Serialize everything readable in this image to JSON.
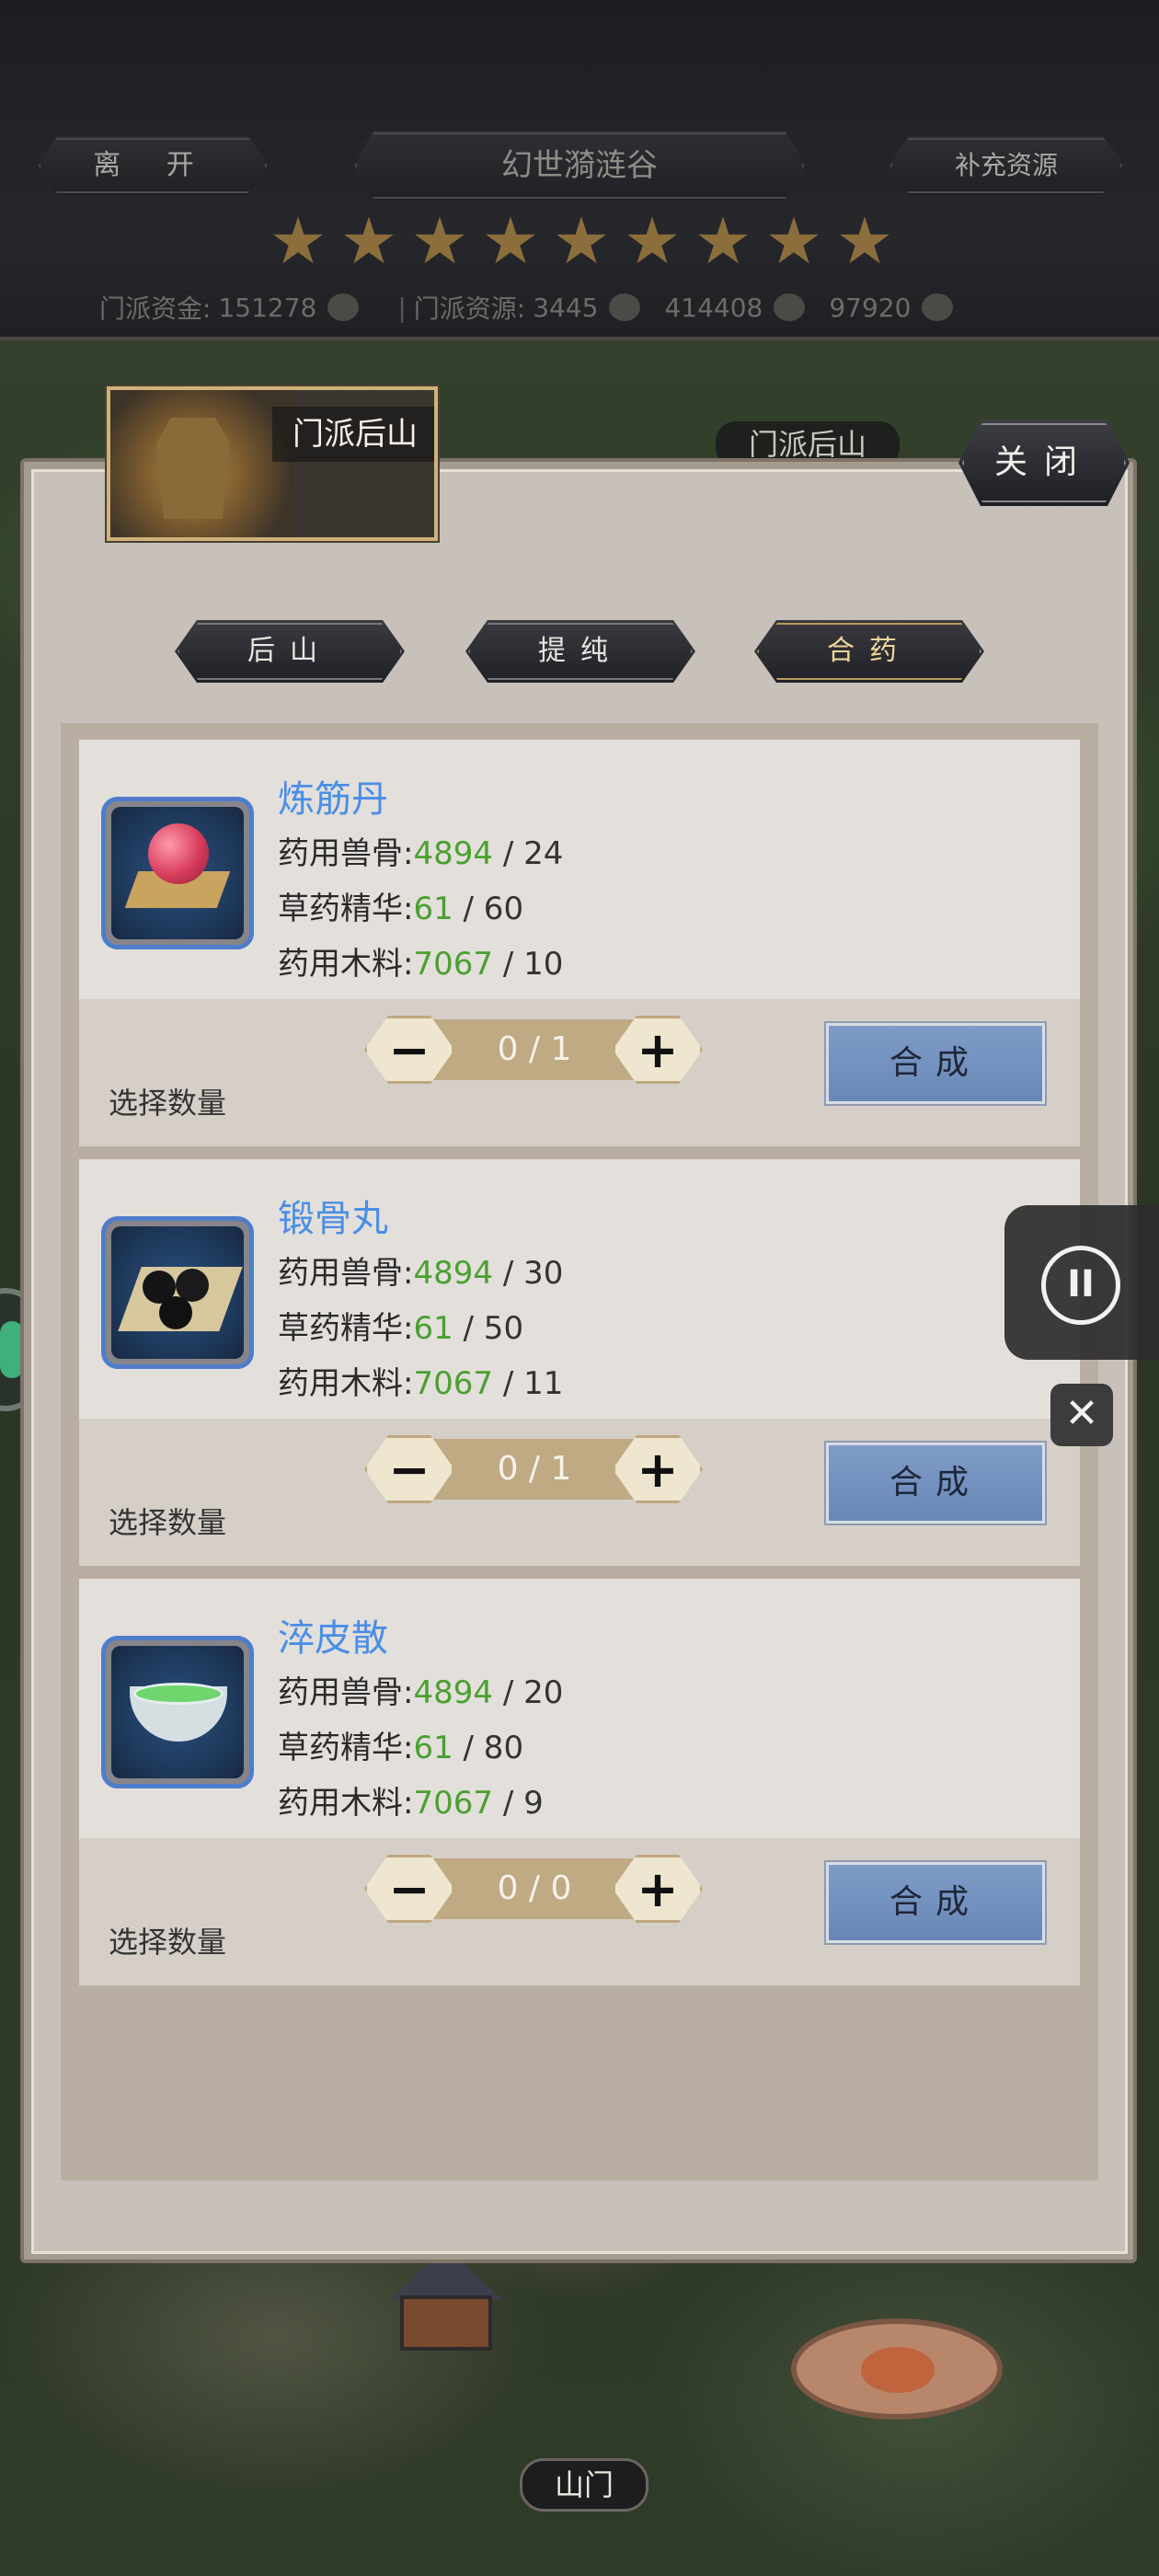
{
  "topbar": {
    "leave_label": "离 开",
    "title": "幻世漪涟谷",
    "supply_label": "补充资源",
    "star_count": 9,
    "resources": {
      "funds_label": "门派资金:",
      "funds_value": "151278",
      "res_label": "门派资源:",
      "res_value": "3445",
      "third_value": "414408",
      "fourth_value": "97920",
      "separator": "|"
    }
  },
  "map": {
    "area_label": "门派后山",
    "gate_label": "山门"
  },
  "panel": {
    "header_title": "门派后山",
    "close_label": "关闭",
    "tabs": [
      "后山",
      "提纯",
      "合药"
    ],
    "active_tab": "合药"
  },
  "recipes": [
    {
      "name": "炼筋丹",
      "icon": "red-pill-icon",
      "stats": [
        {
          "label": "药用兽骨:",
          "have": "4894",
          "need": "/ 24"
        },
        {
          "label": "草药精华:",
          "have": "61",
          "need": "/ 60"
        },
        {
          "label": "药用木料:",
          "have": "7067",
          "need": "/ 10"
        }
      ],
      "qty_label": "选择数量",
      "qty_value": "0 / 1",
      "synth_label": "合成"
    },
    {
      "name": "锻骨丸",
      "icon": "black-pills-icon",
      "stats": [
        {
          "label": "药用兽骨:",
          "have": "4894",
          "need": "/ 30"
        },
        {
          "label": "草药精华:",
          "have": "61",
          "need": "/ 50"
        },
        {
          "label": "药用木料:",
          "have": "7067",
          "need": "/ 11"
        }
      ],
      "qty_label": "选择数量",
      "qty_value": "0 / 1",
      "synth_label": "合成"
    },
    {
      "name": "淬皮散",
      "icon": "green-bowl-icon",
      "stats": [
        {
          "label": "药用兽骨:",
          "have": "4894",
          "need": "/ 20"
        },
        {
          "label": "草药精华:",
          "have": "61",
          "need": "/ 80"
        },
        {
          "label": "药用木料:",
          "have": "7067",
          "need": "/ 9"
        }
      ],
      "qty_label": "选择数量",
      "qty_value": "0 / 0",
      "synth_label": "合成"
    }
  ],
  "overlay": {
    "pause_symbol": "II",
    "close_symbol": "✕"
  },
  "colors": {
    "name_blue": "#4a8ee6",
    "have_green": "#4aa030",
    "synth_button": "#7f9cc8",
    "star_gold": "#8b6e3b"
  }
}
